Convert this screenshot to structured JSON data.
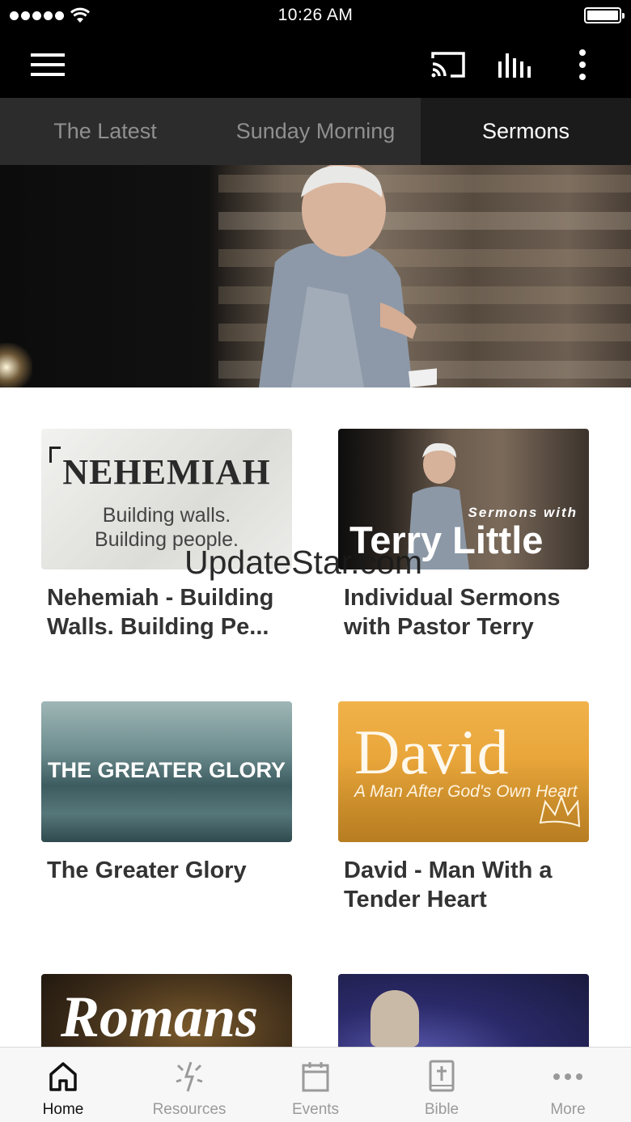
{
  "status_bar": {
    "time": "10:26 AM",
    "signal_icon": "signal-dots-icon",
    "wifi_icon": "wifi-icon",
    "battery_icon": "battery-icon",
    "battery_level": 1.0
  },
  "app_bar": {
    "menu_icon": "hamburger-menu-icon",
    "cast_icon": "cast-icon",
    "audio_icon": "audio-bars-icon",
    "overflow_icon": "more-vertical-icon"
  },
  "tabs": [
    {
      "label": "The Latest",
      "selected": false
    },
    {
      "label": "Sunday Morning",
      "selected": false
    },
    {
      "label": "Sermons",
      "selected": true
    }
  ],
  "colors": {
    "app_bar": "#000000",
    "tab_bar": "#2c2c2c",
    "tab_selected": "#1b1b1b",
    "card_title": "#333333",
    "nav_inactive": "#9a9a9a",
    "nav_active": "#111111"
  },
  "series": [
    {
      "title": "Nehemiah - Building Walls. Building Pe...",
      "thumb_heading": "NEHEMIAH",
      "thumb_lines": [
        "Building walls.",
        "Building people."
      ]
    },
    {
      "title": "Individual Sermons with Pastor Terry",
      "thumb_small": "Sermons with",
      "thumb_big": "Terry Little"
    },
    {
      "title": "The Greater Glory",
      "thumb_text": "THE GREATER GLORY"
    },
    {
      "title": "David - Man With a Tender Heart",
      "thumb_heading": "David",
      "thumb_sub": "A Man After God's Own Heart"
    },
    {
      "title": "",
      "thumb_heading": "Romans"
    },
    {
      "title": ""
    }
  ],
  "watermark": "UpdateStar.com",
  "bottom_nav": [
    {
      "label": "Home",
      "icon": "home-icon",
      "active": true
    },
    {
      "label": "Resources",
      "icon": "sparkle-icon",
      "active": false
    },
    {
      "label": "Events",
      "icon": "calendar-icon",
      "active": false
    },
    {
      "label": "Bible",
      "icon": "bible-icon",
      "active": false
    },
    {
      "label": "More",
      "icon": "more-horizontal-icon",
      "active": false
    }
  ]
}
